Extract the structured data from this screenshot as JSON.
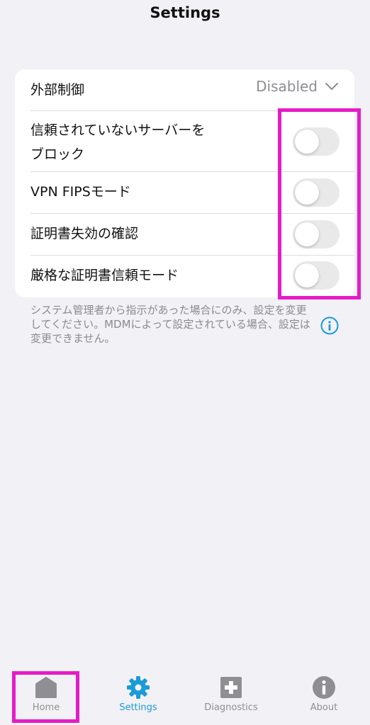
{
  "header": {
    "title": "Settings"
  },
  "settings": {
    "external_control": {
      "label": "外部制御",
      "value": "Disabled"
    },
    "toggles": [
      {
        "label": "信頼されていないサーバーを\nブロック",
        "on": false
      },
      {
        "label": "VPN FIPSモード",
        "on": false
      },
      {
        "label": "証明書失効の確認",
        "on": false
      },
      {
        "label": "厳格な証明書信頼モード",
        "on": false
      }
    ],
    "footer_note": "システム管理者から指示があった場合にのみ、設定を変更してください。MDMによって設定されている場合、設定は変更できません。"
  },
  "tabbar": {
    "tabs": [
      {
        "label": "Home",
        "icon": "home-icon",
        "active": false
      },
      {
        "label": "Settings",
        "icon": "gear-icon",
        "active": true
      },
      {
        "label": "Diagnostics",
        "icon": "diagnostics-plus-icon",
        "active": false
      },
      {
        "label": "About",
        "icon": "info-icon",
        "active": false
      }
    ]
  },
  "colors": {
    "background": "#f2f1f6",
    "card": "#ffffff",
    "accent": "#1a9bd7",
    "highlight": "#e61bc8",
    "inactive": "#8e8e93"
  }
}
